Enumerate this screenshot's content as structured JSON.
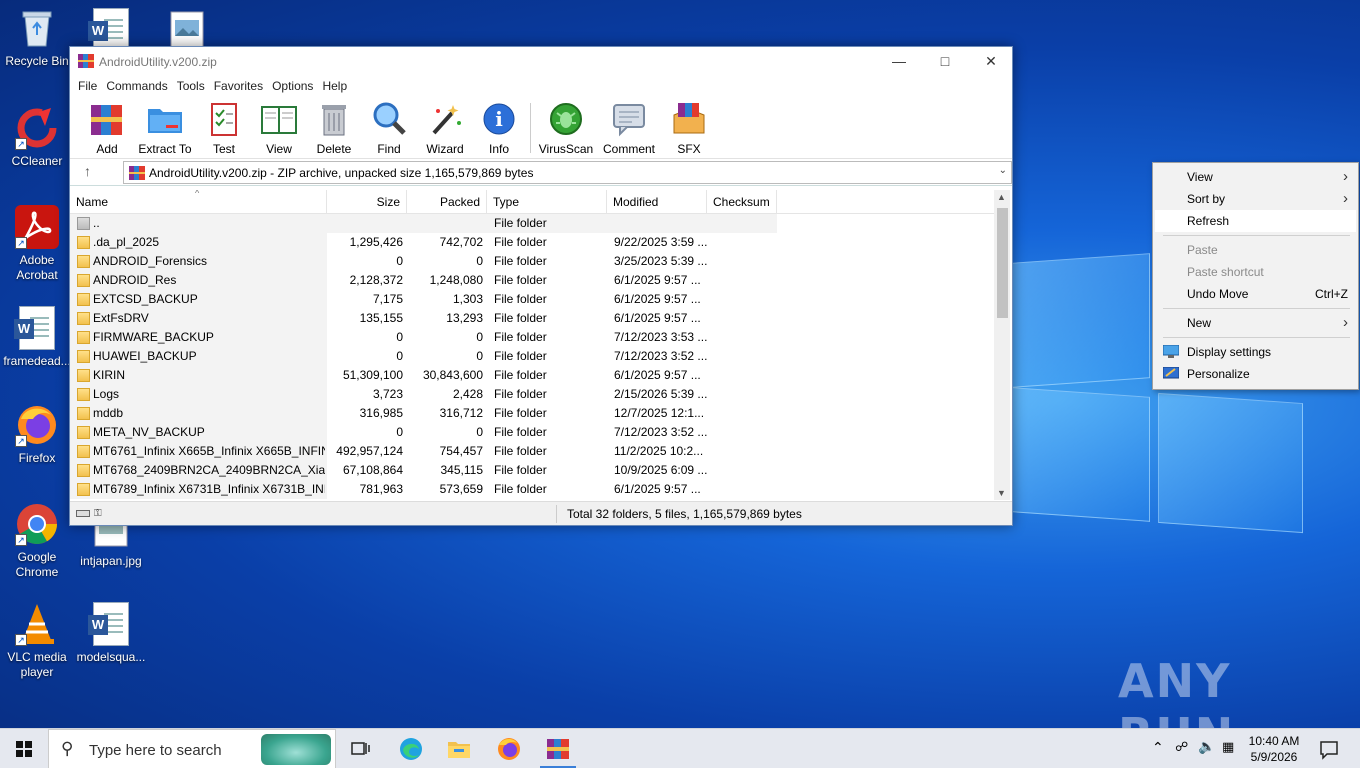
{
  "desktop": {
    "icons": [
      {
        "label": "Recycle Bin"
      },
      {
        "label": "CCleaner"
      },
      {
        "label": "Adobe Acrobat"
      },
      {
        "label": "framedead..."
      },
      {
        "label": "Firefox"
      },
      {
        "label": "Google Chrome"
      },
      {
        "label": "intjapan.jpg"
      },
      {
        "label": "VLC media player"
      },
      {
        "label": "modelsqua..."
      }
    ],
    "watermark": "ANY RUN"
  },
  "winrar": {
    "title": "AndroidUtility.v200.zip",
    "menu": [
      "File",
      "Commands",
      "Tools",
      "Favorites",
      "Options",
      "Help"
    ],
    "toolbar": [
      "Add",
      "Extract To",
      "Test",
      "View",
      "Delete",
      "Find",
      "Wizard",
      "Info",
      "VirusScan",
      "Comment",
      "SFX"
    ],
    "address": "AndroidUtility.v200.zip - ZIP archive, unpacked size 1,165,579,869 bytes",
    "columns": [
      "Name",
      "Size",
      "Packed",
      "Type",
      "Modified",
      "Checksum"
    ],
    "parent_row": {
      "name": "..",
      "type": "File folder"
    },
    "rows": [
      {
        "name": ".da_pl_2025",
        "size": "1,295,426",
        "packed": "742,702",
        "type": "File folder",
        "modified": "9/22/2025 3:59 ..."
      },
      {
        "name": "ANDROID_Forensics",
        "size": "0",
        "packed": "0",
        "type": "File folder",
        "modified": "3/25/2023 5:39 ..."
      },
      {
        "name": "ANDROID_Res",
        "size": "2,128,372",
        "packed": "1,248,080",
        "type": "File folder",
        "modified": "6/1/2025 9:57 ..."
      },
      {
        "name": "EXTCSD_BACKUP",
        "size": "7,175",
        "packed": "1,303",
        "type": "File folder",
        "modified": "6/1/2025 9:57 ..."
      },
      {
        "name": "ExtFsDRV",
        "size": "135,155",
        "packed": "13,293",
        "type": "File folder",
        "modified": "6/1/2025 9:57 ..."
      },
      {
        "name": "FIRMWARE_BACKUP",
        "size": "0",
        "packed": "0",
        "type": "File folder",
        "modified": "7/12/2023 3:53 ..."
      },
      {
        "name": "HUAWEI_BACKUP",
        "size": "0",
        "packed": "0",
        "type": "File folder",
        "modified": "7/12/2023 3:52 ..."
      },
      {
        "name": "KIRIN",
        "size": "51,309,100",
        "packed": "30,843,600",
        "type": "File folder",
        "modified": "6/1/2025 9:57 ..."
      },
      {
        "name": "Logs",
        "size": "3,723",
        "packed": "2,428",
        "type": "File folder",
        "modified": "2/15/2026 5:39 ..."
      },
      {
        "name": "mddb",
        "size": "316,985",
        "packed": "316,712",
        "type": "File folder",
        "modified": "12/7/2025 12:1..."
      },
      {
        "name": "META_NV_BACKUP",
        "size": "0",
        "packed": "0",
        "type": "File folder",
        "modified": "7/12/2023 3:52 ..."
      },
      {
        "name": "MT6761_Infinix X665B_Infinix X665B_INFIN...",
        "size": "492,957,124",
        "packed": "754,457",
        "type": "File folder",
        "modified": "11/2/2025 10:2..."
      },
      {
        "name": "MT6768_2409BRN2CA_2409BRN2CA_Xiao...",
        "size": "67,108,864",
        "packed": "345,115",
        "type": "File folder",
        "modified": "10/9/2025 6:09 ..."
      },
      {
        "name": "MT6789_Infinix X6731B_Infinix X6731B_INF...",
        "size": "781,963",
        "packed": "573,659",
        "type": "File folder",
        "modified": "6/1/2025 9:57 ..."
      }
    ],
    "status": "Total 32 folders, 5 files, 1,165,579,869 bytes"
  },
  "context_menu": {
    "items": [
      {
        "label": "View",
        "submenu": true,
        "disabled": false
      },
      {
        "label": "Sort by",
        "submenu": true,
        "disabled": false
      },
      {
        "label": "Refresh",
        "disabled": false,
        "highlighted": true
      },
      {
        "label": "Paste",
        "disabled": true
      },
      {
        "label": "Paste shortcut",
        "disabled": true
      },
      {
        "label": "Undo Move",
        "accel": "Ctrl+Z",
        "disabled": false
      },
      {
        "label": "New",
        "submenu": true,
        "disabled": false
      },
      {
        "label": "Display settings",
        "icon": "display-icon",
        "disabled": false
      },
      {
        "label": "Personalize",
        "icon": "personalize-icon",
        "disabled": false
      }
    ]
  },
  "taskbar": {
    "search_placeholder": "Type here to search",
    "time": "10:40 AM",
    "date": "5/9/2026"
  }
}
